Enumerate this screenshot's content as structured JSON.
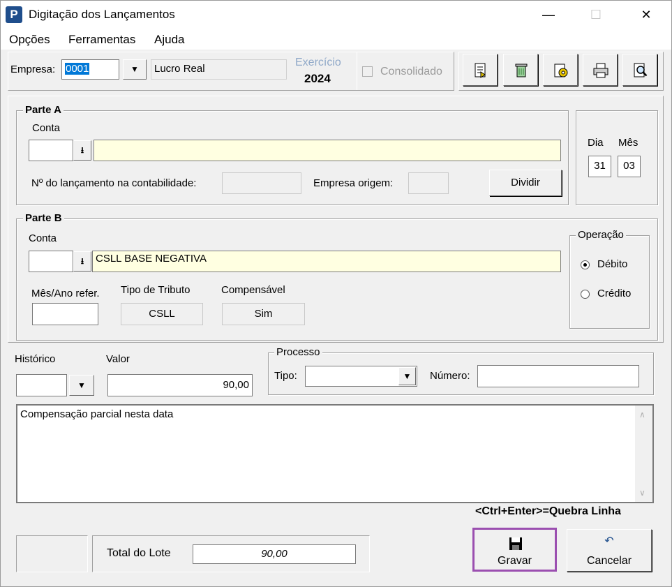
{
  "window": {
    "title": "Digitação dos Lançamentos",
    "app_icon": "P",
    "minimize_icon": "—",
    "maximize_icon": "☐",
    "close_icon": "✕"
  },
  "menu": {
    "opcoes": "Opções",
    "ferramentas": "Ferramentas",
    "ajuda": "Ajuda"
  },
  "header": {
    "empresa_label": "Empresa:",
    "empresa_value": "0001",
    "regime": "Lucro Real",
    "exercicio_label": "Exercício",
    "exercicio_value": "2024",
    "consolidado_label": "Consolidado"
  },
  "parte_a": {
    "legend": "Parte A",
    "conta_label": "Conta",
    "conta_code": "",
    "conta_desc": "",
    "num_lanc_label": "Nº do lançamento na contabilidade:",
    "num_lanc_value": "",
    "empresa_origem_label": "Empresa origem:",
    "empresa_origem_value": "",
    "dividir_label": "Dividir"
  },
  "date": {
    "dia_label": "Dia",
    "mes_label": "Mês",
    "dia_value": "31",
    "mes_value": "03"
  },
  "parte_b": {
    "legend": "Parte B",
    "conta_label": "Conta",
    "conta_code": "",
    "conta_desc": "CSLL BASE NEGATIVA",
    "mes_ano_label": "Mês/Ano refer.",
    "mes_ano_value": "",
    "tipo_tributo_label": "Tipo de Tributo",
    "tipo_tributo_value": "CSLL",
    "compensavel_label": "Compensável",
    "compensavel_value": "Sim"
  },
  "operacao": {
    "legend": "Operação",
    "debito_label": "Débito",
    "credito_label": "Crédito",
    "selected": "Débito"
  },
  "lancamento": {
    "historico_label": "Histórico",
    "historico_value": "",
    "valor_label": "Valor",
    "valor_value": "90,00"
  },
  "processo": {
    "legend": "Processo",
    "tipo_label": "Tipo:",
    "tipo_value": "",
    "numero_label": "Número:",
    "numero_value": ""
  },
  "memo": {
    "text": "Compensação parcial nesta data",
    "hint": "<Ctrl+Enter>=Quebra Linha"
  },
  "footer": {
    "total_lote_label": "Total do Lote",
    "total_lote_value": "90,00",
    "gravar_label": "Gravar",
    "cancelar_label": "Cancelar"
  },
  "colors": {
    "highlight_border": "#9b4fb0",
    "field_yellow": "#ffffe1",
    "selection": "#0078d7"
  }
}
